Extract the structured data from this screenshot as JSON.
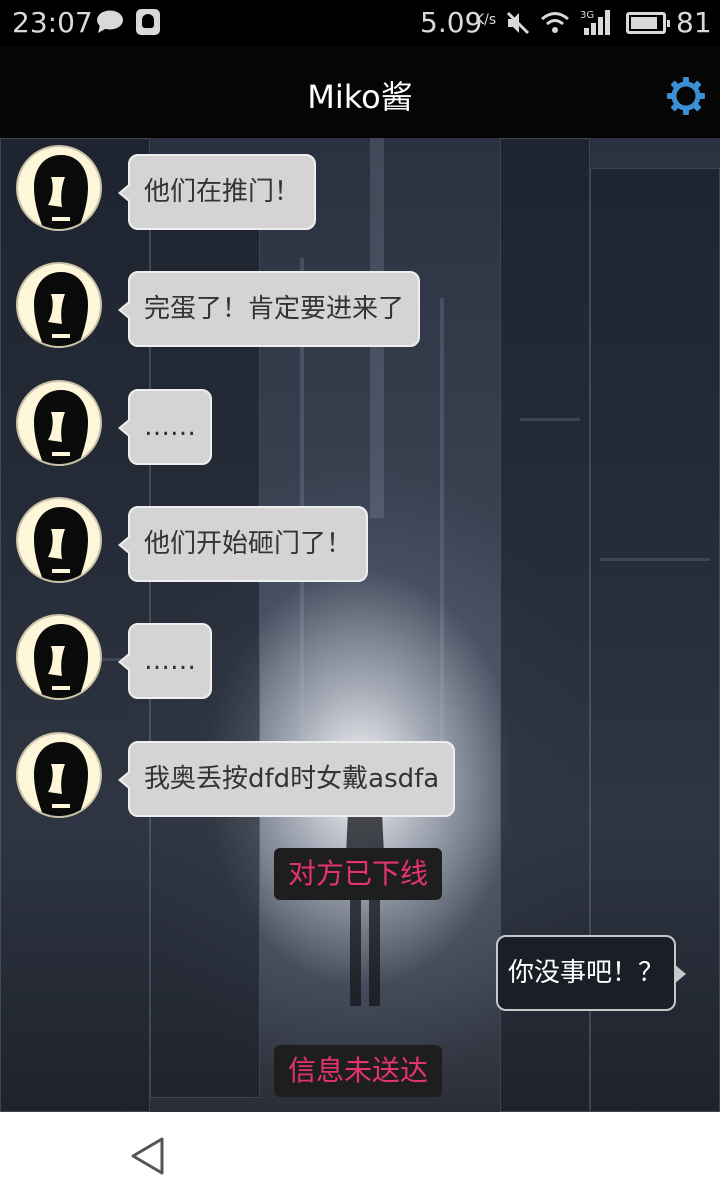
{
  "status_bar": {
    "time": "23:07",
    "network_speed": "5.09",
    "network_speed_unit": "K/s",
    "signal_label": "3G",
    "battery": "81",
    "icons": [
      "chat-notification-icon",
      "qq-icon",
      "mute-icon",
      "wifi-icon",
      "signal-icon",
      "battery-icon"
    ]
  },
  "header": {
    "title": "Miko酱",
    "settings_icon": "gear-icon"
  },
  "messages": [
    {
      "text": "他们在推门！"
    },
    {
      "text": "完蛋了！肯定要进来了"
    },
    {
      "text": "……"
    },
    {
      "text": "他们开始砸门了！"
    },
    {
      "text": "……"
    },
    {
      "text": "我奥丢按dfd时女戴asdfa"
    }
  ],
  "system_notice_offline": "对方已下线",
  "outgoing_message": "你没事吧！？",
  "system_notice_failed": "信息未送达",
  "colors": {
    "system_text": "#e5336f",
    "incoming_bubble": "#d4d4d4",
    "outgoing_bubble": "#1a1e26",
    "gear": "#3b8fd6"
  },
  "nav": {
    "back_icon": "back-triangle-icon"
  }
}
